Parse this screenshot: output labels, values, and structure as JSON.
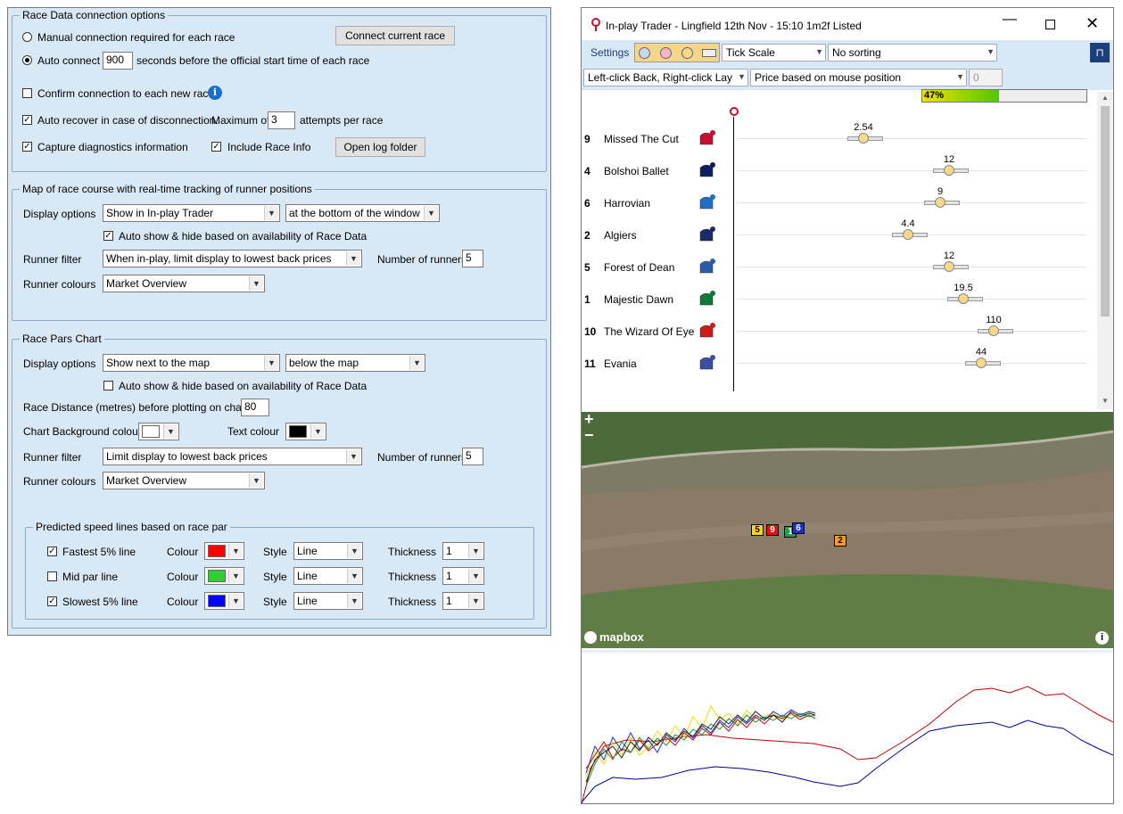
{
  "race_data": {
    "title": "Race Data connection options",
    "manual_label": "Manual connection required for each race",
    "connect_btn": "Connect current race",
    "auto_label": "Auto connect",
    "auto_seconds": "900",
    "auto_suffix": "seconds before the official start time of each race",
    "confirm_label": "Confirm connection to each new race",
    "recover_label": "Auto recover in case of disconnection.",
    "recover_max": "Maximum of",
    "recover_attempts": "3",
    "recover_suffix": "attempts per race",
    "diag_label": "Capture diagnostics information",
    "include_race_info": "Include Race Info",
    "open_log_btn": "Open log folder"
  },
  "map_section": {
    "title": "Map of race course with real-time tracking of runner positions",
    "display_label": "Display options",
    "display_value": "Show in In-play Trader",
    "position_value": "at the bottom of the window",
    "auto_show_label": "Auto show & hide based on availability of Race Data",
    "runner_filter_label": "Runner filter",
    "runner_filter_value": "When in-play, limit display to lowest back prices",
    "num_runners_label": "Number of runners",
    "num_runners": "5",
    "runner_colours_label": "Runner colours",
    "runner_colours_value": "Market Overview"
  },
  "pars_section": {
    "title": "Race Pars Chart",
    "display_label": "Display options",
    "display_value": "Show next to the map",
    "position_value": "below the map",
    "auto_show_label": "Auto show & hide based on availability of Race Data",
    "distance_label": "Race Distance (metres) before plotting on chart",
    "distance_value": "80",
    "bg_colour_label": "Chart Background colour",
    "text_colour_label": "Text colour",
    "runner_filter_label": "Runner filter",
    "runner_filter_value": "Limit display to lowest back prices",
    "num_runners_label": "Number of runners",
    "num_runners": "5",
    "runner_colours_label": "Runner colours",
    "runner_colours_value": "Market Overview"
  },
  "speed_lines": {
    "title": "Predicted speed lines based on race par",
    "colour_label": "Colour",
    "style_label": "Style",
    "thickness_label": "Thickness",
    "lines": [
      {
        "label": "Fastest 5% line",
        "checked": true,
        "colour": "#ff0000",
        "style": "Line",
        "thickness": "1"
      },
      {
        "label": "Mid par line",
        "checked": false,
        "colour": "#33cc33",
        "style": "Line",
        "thickness": "1"
      },
      {
        "label": "Slowest 5% line",
        "checked": true,
        "colour": "#0000ff",
        "style": "Line",
        "thickness": "1"
      }
    ]
  },
  "trader": {
    "title": "In-play Trader - Lingfield 12th Nov - 15:10 1m2f Listed",
    "settings_label": "Settings",
    "tick_scale": "Tick Scale",
    "sorting": "No sorting",
    "click_mode": "Left-click Back, Right-click Lay",
    "price_mode": "Price based on mouse position",
    "price_value": "0",
    "progress_label": "47%",
    "progress": 0.47
  },
  "runners": [
    {
      "num": "9",
      "name": "Missed The Cut",
      "price": "2.54",
      "price_value": 2.54,
      "silk": "#c8102e"
    },
    {
      "num": "4",
      "name": "Bolshoi Ballet",
      "price": "12",
      "price_value": 12,
      "silk": "#0a1f5c"
    },
    {
      "num": "6",
      "name": "Harrovian",
      "price": "9",
      "price_value": 9,
      "silk": "#1f6fc4"
    },
    {
      "num": "2",
      "name": "Algiers",
      "price": "4.4",
      "price_value": 4.4,
      "silk": "#1c2a6b"
    },
    {
      "num": "5",
      "name": "Forest of Dean",
      "price": "12",
      "price_value": 12,
      "silk": "#2a5caa"
    },
    {
      "num": "1",
      "name": "Majestic Dawn",
      "price": "19.5",
      "price_value": 19.5,
      "silk": "#0e7a3a"
    },
    {
      "num": "10",
      "name": "The Wizard Of Eye",
      "price": "110",
      "price_value": 110,
      "silk": "#cc1a1a"
    },
    {
      "num": "11",
      "name": "Evania",
      "price": "44",
      "price_value": 44,
      "silk": "#3a4fa0"
    }
  ],
  "map": {
    "zoom_in": "+",
    "zoom_out": "−",
    "attribution": "mapbox",
    "markers": [
      {
        "label": "5",
        "color": "#ffd700",
        "text": "#000"
      },
      {
        "label": "9",
        "color": "#e01010",
        "text": "#fff"
      },
      {
        "label": "1",
        "color": "#1aa34a",
        "text": "#fff"
      },
      {
        "label": "6",
        "color": "#1a2fcc",
        "text": "#fff"
      },
      {
        "label": "2",
        "color": "#ff9a1a",
        "text": "#000"
      }
    ]
  }
}
